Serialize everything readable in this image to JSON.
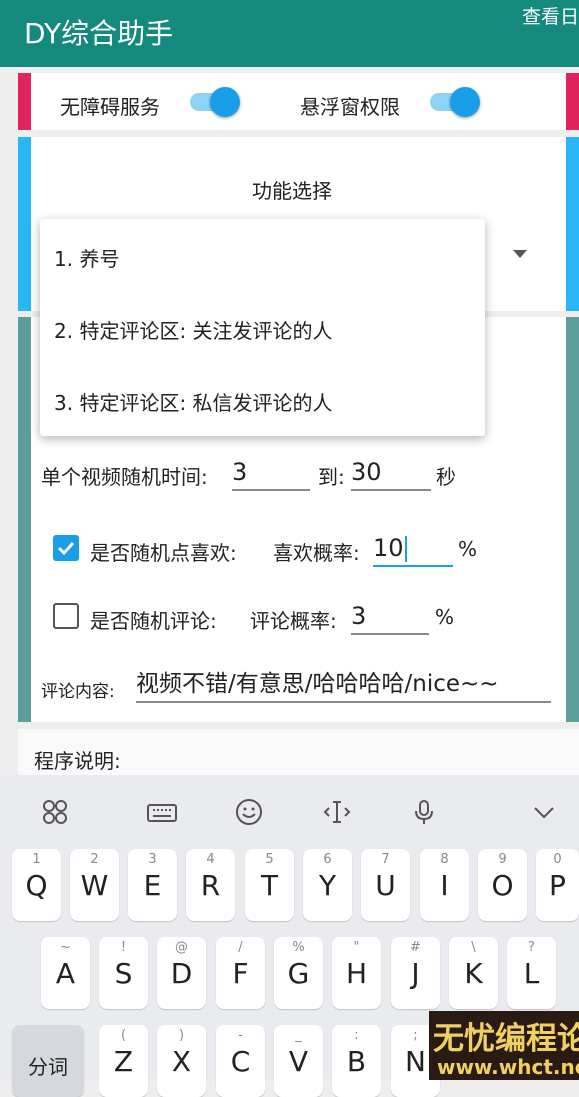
{
  "app": {
    "title": "DY综合助手",
    "action_label": "查看日"
  },
  "permissions": {
    "accessibility_label": "无障碍服务",
    "accessibility_on": true,
    "overlay_label": "悬浮窗权限",
    "overlay_on": true
  },
  "feature": {
    "header": "功能选择",
    "options": [
      "1. 养号",
      "2. 特定评论区: 关注发评论的人",
      "3. 特定评论区: 私信发评论的人"
    ]
  },
  "settings": {
    "video_time_label": "单个视频随机时间:",
    "video_time_from": "3",
    "to_label": "到:",
    "video_time_to": "30",
    "seconds_unit": "秒",
    "random_like_label": "是否随机点喜欢:",
    "random_like_checked": true,
    "like_prob_label": "喜欢概率:",
    "like_prob_value": "10",
    "percent": "%",
    "random_comment_label": "是否随机评论:",
    "random_comment_checked": false,
    "comment_prob_label": "评论概率:",
    "comment_prob_value": "3",
    "comment_content_label": "评论内容:",
    "comment_content_value": "视频不错/有意思/哈哈哈哈/nice~~"
  },
  "program_desc_label": "程序说明:",
  "keyboard": {
    "toolbar": [
      "grid-icon",
      "keyboard-icon",
      "emoji-icon",
      "text-cursor-icon",
      "mic-icon",
      "chevron-down-icon"
    ],
    "row1": [
      {
        "k": "Q",
        "h": "1"
      },
      {
        "k": "W",
        "h": "2"
      },
      {
        "k": "E",
        "h": "3"
      },
      {
        "k": "R",
        "h": "4"
      },
      {
        "k": "T",
        "h": "5"
      },
      {
        "k": "Y",
        "h": "6"
      },
      {
        "k": "U",
        "h": "7"
      },
      {
        "k": "I",
        "h": "8"
      },
      {
        "k": "O",
        "h": "9"
      },
      {
        "k": "P",
        "h": "0"
      }
    ],
    "row2": [
      {
        "k": "A",
        "h": "~"
      },
      {
        "k": "S",
        "h": "!"
      },
      {
        "k": "D",
        "h": "@"
      },
      {
        "k": "F",
        "h": "/"
      },
      {
        "k": "G",
        "h": "%"
      },
      {
        "k": "H",
        "h": "\""
      },
      {
        "k": "J",
        "h": "#"
      },
      {
        "k": "K",
        "h": "\\"
      },
      {
        "k": "L",
        "h": "?"
      }
    ],
    "row3_left": "分词",
    "row3": [
      {
        "k": "Z",
        "h": "("
      },
      {
        "k": "X",
        "h": ")"
      },
      {
        "k": "C",
        "h": "-"
      },
      {
        "k": "V",
        "h": "_"
      },
      {
        "k": "B",
        "h": ":"
      },
      {
        "k": "N",
        "h": ";"
      }
    ]
  },
  "watermark": {
    "line1": "无忧编程论坛",
    "line2": "www.whct.net"
  },
  "colors": {
    "appbar": "#14897d",
    "accent": "#1a9ee8",
    "stripe_red": "#e0245e",
    "stripe_blue": "#29b6f6",
    "stripe_teal": "#5e9e9a"
  }
}
